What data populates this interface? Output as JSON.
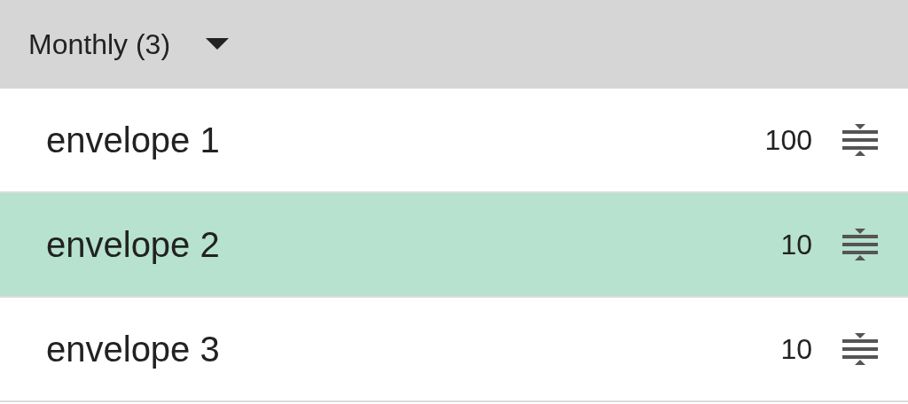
{
  "group": {
    "title": "Monthly (3)",
    "expanded": true
  },
  "envelopes": [
    {
      "name": "envelope 1",
      "amount": "100",
      "selected": false
    },
    {
      "name": "envelope 2",
      "amount": "10",
      "selected": true
    },
    {
      "name": "envelope 3",
      "amount": "10",
      "selected": false
    }
  ]
}
